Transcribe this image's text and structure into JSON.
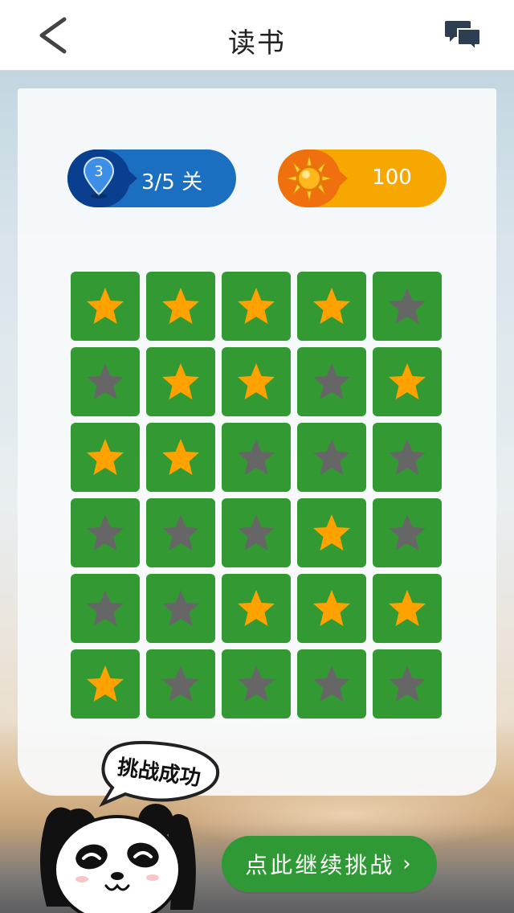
{
  "header": {
    "title": "读书",
    "back_icon": "chevron-left-icon",
    "chat_icon": "chat-bubbles-icon"
  },
  "level": {
    "badge_number": "3",
    "text": "3/5 关"
  },
  "score": {
    "icon": "sun-icon",
    "value": "100"
  },
  "grid": {
    "rows": [
      [
        "gold",
        "gold",
        "gold",
        "gold",
        "gray"
      ],
      [
        "gray",
        "gold",
        "gold",
        "gray",
        "gold"
      ],
      [
        "gold",
        "gold",
        "gray",
        "gray",
        "gray"
      ],
      [
        "gray",
        "gray",
        "gray",
        "gold",
        "gray"
      ],
      [
        "gray",
        "gray",
        "gold",
        "gold",
        "gold"
      ],
      [
        "gold",
        "gray",
        "gray",
        "gray",
        "gray"
      ]
    ]
  },
  "mascot": {
    "speech": "挑战成功"
  },
  "continue_button": {
    "label": "点此继续挑战",
    "arrow": "›"
  },
  "colors": {
    "cell_green": "#339a33",
    "star_gold": "#ffa200",
    "star_gray": "#666666",
    "level_blue": "#1a6fc0",
    "score_orange": "#f7a800"
  }
}
